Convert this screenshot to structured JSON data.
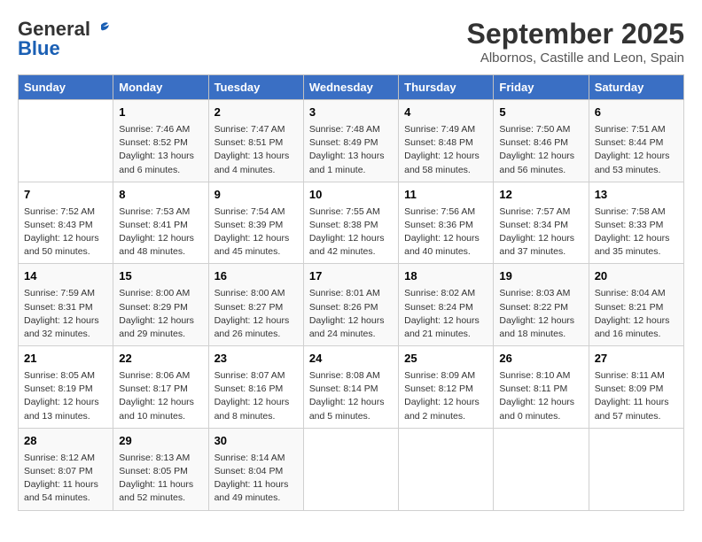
{
  "header": {
    "logo_line1": "General",
    "logo_line2": "Blue",
    "month": "September 2025",
    "location": "Albornos, Castille and Leon, Spain"
  },
  "weekdays": [
    "Sunday",
    "Monday",
    "Tuesday",
    "Wednesday",
    "Thursday",
    "Friday",
    "Saturday"
  ],
  "weeks": [
    [
      {
        "day": "",
        "info": ""
      },
      {
        "day": "1",
        "info": "Sunrise: 7:46 AM\nSunset: 8:52 PM\nDaylight: 13 hours\nand 6 minutes."
      },
      {
        "day": "2",
        "info": "Sunrise: 7:47 AM\nSunset: 8:51 PM\nDaylight: 13 hours\nand 4 minutes."
      },
      {
        "day": "3",
        "info": "Sunrise: 7:48 AM\nSunset: 8:49 PM\nDaylight: 13 hours\nand 1 minute."
      },
      {
        "day": "4",
        "info": "Sunrise: 7:49 AM\nSunset: 8:48 PM\nDaylight: 12 hours\nand 58 minutes."
      },
      {
        "day": "5",
        "info": "Sunrise: 7:50 AM\nSunset: 8:46 PM\nDaylight: 12 hours\nand 56 minutes."
      },
      {
        "day": "6",
        "info": "Sunrise: 7:51 AM\nSunset: 8:44 PM\nDaylight: 12 hours\nand 53 minutes."
      }
    ],
    [
      {
        "day": "7",
        "info": "Sunrise: 7:52 AM\nSunset: 8:43 PM\nDaylight: 12 hours\nand 50 minutes."
      },
      {
        "day": "8",
        "info": "Sunrise: 7:53 AM\nSunset: 8:41 PM\nDaylight: 12 hours\nand 48 minutes."
      },
      {
        "day": "9",
        "info": "Sunrise: 7:54 AM\nSunset: 8:39 PM\nDaylight: 12 hours\nand 45 minutes."
      },
      {
        "day": "10",
        "info": "Sunrise: 7:55 AM\nSunset: 8:38 PM\nDaylight: 12 hours\nand 42 minutes."
      },
      {
        "day": "11",
        "info": "Sunrise: 7:56 AM\nSunset: 8:36 PM\nDaylight: 12 hours\nand 40 minutes."
      },
      {
        "day": "12",
        "info": "Sunrise: 7:57 AM\nSunset: 8:34 PM\nDaylight: 12 hours\nand 37 minutes."
      },
      {
        "day": "13",
        "info": "Sunrise: 7:58 AM\nSunset: 8:33 PM\nDaylight: 12 hours\nand 35 minutes."
      }
    ],
    [
      {
        "day": "14",
        "info": "Sunrise: 7:59 AM\nSunset: 8:31 PM\nDaylight: 12 hours\nand 32 minutes."
      },
      {
        "day": "15",
        "info": "Sunrise: 8:00 AM\nSunset: 8:29 PM\nDaylight: 12 hours\nand 29 minutes."
      },
      {
        "day": "16",
        "info": "Sunrise: 8:00 AM\nSunset: 8:27 PM\nDaylight: 12 hours\nand 26 minutes."
      },
      {
        "day": "17",
        "info": "Sunrise: 8:01 AM\nSunset: 8:26 PM\nDaylight: 12 hours\nand 24 minutes."
      },
      {
        "day": "18",
        "info": "Sunrise: 8:02 AM\nSunset: 8:24 PM\nDaylight: 12 hours\nand 21 minutes."
      },
      {
        "day": "19",
        "info": "Sunrise: 8:03 AM\nSunset: 8:22 PM\nDaylight: 12 hours\nand 18 minutes."
      },
      {
        "day": "20",
        "info": "Sunrise: 8:04 AM\nSunset: 8:21 PM\nDaylight: 12 hours\nand 16 minutes."
      }
    ],
    [
      {
        "day": "21",
        "info": "Sunrise: 8:05 AM\nSunset: 8:19 PM\nDaylight: 12 hours\nand 13 minutes."
      },
      {
        "day": "22",
        "info": "Sunrise: 8:06 AM\nSunset: 8:17 PM\nDaylight: 12 hours\nand 10 minutes."
      },
      {
        "day": "23",
        "info": "Sunrise: 8:07 AM\nSunset: 8:16 PM\nDaylight: 12 hours\nand 8 minutes."
      },
      {
        "day": "24",
        "info": "Sunrise: 8:08 AM\nSunset: 8:14 PM\nDaylight: 12 hours\nand 5 minutes."
      },
      {
        "day": "25",
        "info": "Sunrise: 8:09 AM\nSunset: 8:12 PM\nDaylight: 12 hours\nand 2 minutes."
      },
      {
        "day": "26",
        "info": "Sunrise: 8:10 AM\nSunset: 8:11 PM\nDaylight: 12 hours\nand 0 minutes."
      },
      {
        "day": "27",
        "info": "Sunrise: 8:11 AM\nSunset: 8:09 PM\nDaylight: 11 hours\nand 57 minutes."
      }
    ],
    [
      {
        "day": "28",
        "info": "Sunrise: 8:12 AM\nSunset: 8:07 PM\nDaylight: 11 hours\nand 54 minutes."
      },
      {
        "day": "29",
        "info": "Sunrise: 8:13 AM\nSunset: 8:05 PM\nDaylight: 11 hours\nand 52 minutes."
      },
      {
        "day": "30",
        "info": "Sunrise: 8:14 AM\nSunset: 8:04 PM\nDaylight: 11 hours\nand 49 minutes."
      },
      {
        "day": "",
        "info": ""
      },
      {
        "day": "",
        "info": ""
      },
      {
        "day": "",
        "info": ""
      },
      {
        "day": "",
        "info": ""
      }
    ]
  ]
}
